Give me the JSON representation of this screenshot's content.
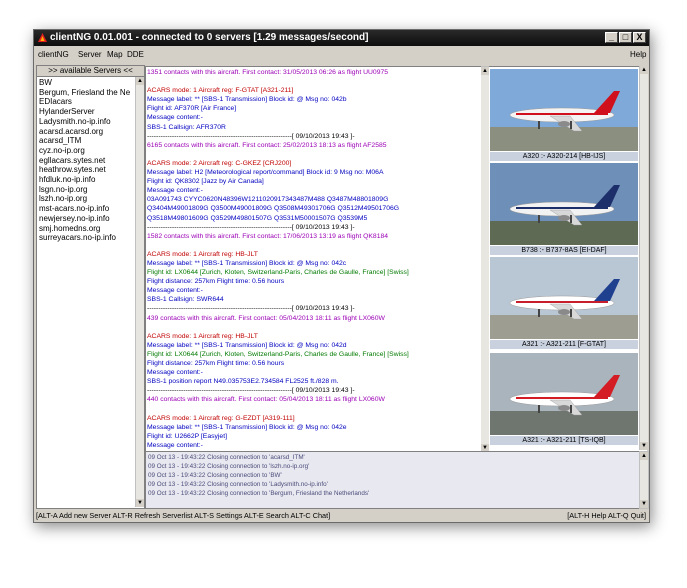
{
  "window": {
    "title": "clientNG 0.01.001 - connected to 0 servers  [1.29 messages/second]",
    "controls": [
      "_",
      "□",
      "X"
    ]
  },
  "menu": {
    "items": [
      "clientNG",
      "Server",
      "Map",
      "DDE"
    ],
    "help": "Help"
  },
  "servers": {
    "button_label": ">> available Servers <<",
    "items": [
      "BW",
      "Bergum, Friesland the Ne",
      "EDIacars",
      "HylanderServer",
      "Ladysmith.no-ip.info",
      "acarsd.acarsd.org",
      "acarsd_ITM",
      "cyz.no-ip.org",
      "egllacars.sytes.net",
      "heathrow.sytes.net",
      "hfdluk.no-ip.info",
      "lsgn.no-ip.org",
      "lszh.no-ip.org",
      "mst-acars.no-ip.info",
      "newjersey.no-ip.info",
      "smj.homedns.org",
      "surreyacars.no-ip.info"
    ]
  },
  "messages": [
    {
      "t": "1351 contacts with this aircraft. First contact: 31/05/2013 06:26 as flight UU0975",
      "c": "c-purple"
    },
    {
      "t": "",
      "c": ""
    },
    {
      "t": "ACARS mode: 1  Aircraft reg: F-GTAT  [A321-211]",
      "c": ""
    },
    {
      "t": "Message label: ** [SBS-1 Transmission]  Block id: @  Msg no: 042b",
      "c": "c-blue"
    },
    {
      "t": "Flight id: AF370R [Air France]",
      "c": "c-blue"
    },
    {
      "t": "Message content:-",
      "c": "c-blue"
    },
    {
      "t": "SBS-1 Callsign: AFR370R",
      "c": "c-blue"
    },
    {
      "t": "----------------------------------------------------------------[ 09/10/2013 19:43 ]-",
      "c": "c-black"
    },
    {
      "t": "6165 contacts with this aircraft. First contact: 25/02/2013 18:13 as flight AF2585",
      "c": "c-purple"
    },
    {
      "t": "",
      "c": ""
    },
    {
      "t": "ACARS mode: 2  Aircraft reg: C-GKEZ  [CRJ200]",
      "c": ""
    },
    {
      "t": "Message label: H2 [Meteorological report/command]  Block id: 9  Msg no: M06A",
      "c": "c-blue"
    },
    {
      "t": "Flight id: QK8302 [Jazz by Air Canada]",
      "c": "c-blue"
    },
    {
      "t": "Message content:-",
      "c": "c-blue"
    },
    {
      "t": "03A091743    CYYC0620N48396W1211020917343487M488    Q3487M48801809G",
      "c": "c-blue"
    },
    {
      "t": "Q3404M49001809G   Q3500M49001809G   Q3508M49301706G   Q3512M49501706G",
      "c": "c-blue"
    },
    {
      "t": "Q3518M49801609G   Q3529M49801507G   Q3531M50001507G   Q3539M5",
      "c": "c-blue"
    },
    {
      "t": "----------------------------------------------------------------[ 09/10/2013 19:43 ]-",
      "c": "c-black"
    },
    {
      "t": "1582 contacts with this aircraft. First contact: 17/06/2013 13:19 as flight QK8184",
      "c": "c-purple"
    },
    {
      "t": "",
      "c": ""
    },
    {
      "t": "ACARS mode: 1  Aircraft reg: HB-JLT",
      "c": ""
    },
    {
      "t": "Message label: ** [SBS-1 Transmission]  Block id: @  Msg no: 042c",
      "c": "c-blue"
    },
    {
      "t": "Flight id: LX0644 [Zurich, Kloten, Switzerland-Paris, Charles de Gaulle, France] [Swiss]",
      "c": "c-green"
    },
    {
      "t": "Flight distance: 257km  Flight time: 0.56 hours",
      "c": "c-blue"
    },
    {
      "t": "Message content:-",
      "c": "c-blue"
    },
    {
      "t": "SBS-1 Callsign: SWR644",
      "c": "c-blue"
    },
    {
      "t": "----------------------------------------------------------------[ 09/10/2013 19:43 ]-",
      "c": "c-black"
    },
    {
      "t": "439 contacts with this aircraft. First contact: 05/04/2013 18:11 as flight LX060W",
      "c": "c-purple"
    },
    {
      "t": "",
      "c": ""
    },
    {
      "t": "ACARS mode: 1  Aircraft reg: HB-JLT",
      "c": ""
    },
    {
      "t": "Message label: ** [SBS-1 Transmission]  Block id: @  Msg no: 042d",
      "c": "c-blue"
    },
    {
      "t": "Flight id: LX0644 [Zurich, Kloten, Switzerland-Paris, Charles de Gaulle, France] [Swiss]",
      "c": "c-green"
    },
    {
      "t": "Flight distance: 257km  Flight time: 0.56 hours",
      "c": "c-blue"
    },
    {
      "t": "Message content:-",
      "c": "c-blue"
    },
    {
      "t": "SBS-1 position report N49.035753E2.734584 FL2525 ft./828 m.",
      "c": "c-blue"
    },
    {
      "t": "----------------------------------------------------------------[ 09/10/2013 19:43 ]-",
      "c": "c-black"
    },
    {
      "t": "440 contacts with this aircraft. First contact: 05/04/2013 18:11 as flight LX060W",
      "c": "c-purple"
    },
    {
      "t": "",
      "c": ""
    },
    {
      "t": "ACARS mode: 1  Aircraft reg: G-EZDT  [A319-111]",
      "c": ""
    },
    {
      "t": "Message label: ** [SBS-1 Transmission]  Block id: @  Msg no: 042e",
      "c": "c-blue"
    },
    {
      "t": "Flight id: U2662P [Easyjet]",
      "c": "c-blue"
    },
    {
      "t": "Message content:-",
      "c": "c-blue"
    }
  ],
  "photos": [
    {
      "caption": "A320 :- A320-214 [HB-IJS]",
      "livery": "swiss"
    },
    {
      "caption": "B738 :- B737-8AS [EI-DAF]",
      "livery": "ryanair"
    },
    {
      "caption": "A321 :- A321-211 [F-GTAT]",
      "livery": "airfrance"
    },
    {
      "caption": "A321 :- A321-211 [TS-IQB]",
      "livery": "tunisair"
    }
  ],
  "log": [
    "09 Oct 13 - 19:43:22 Closing connection to 'acarsd_ITM'",
    "09 Oct 13 - 19:43:22 Closing connection to 'lszh.no-ip.org'",
    "09 Oct 13 - 19:43:22 Closing connection to 'BW'",
    "09 Oct 13 - 19:43:22 Closing connection to 'Ladysmith.no-ip.info'",
    "09 Oct 13 - 19:43:22 Closing connection to 'Bergum, Friesland the Netherlands'"
  ],
  "status": {
    "left": "[ALT-A Add new Server  ALT-R Refresh Serverlist  ALT-S Settings  ALT-E Search  ALT-C Chat]",
    "right": "[ALT-H Help  ALT-Q Quit]"
  },
  "colors": {
    "title_bg": "#1a1a1a",
    "frame": "#d4d0c8",
    "caption_bg": "#c9d1df",
    "text_red": "#c00000",
    "text_blue": "#0000c0",
    "text_purple": "#9b00b5"
  }
}
